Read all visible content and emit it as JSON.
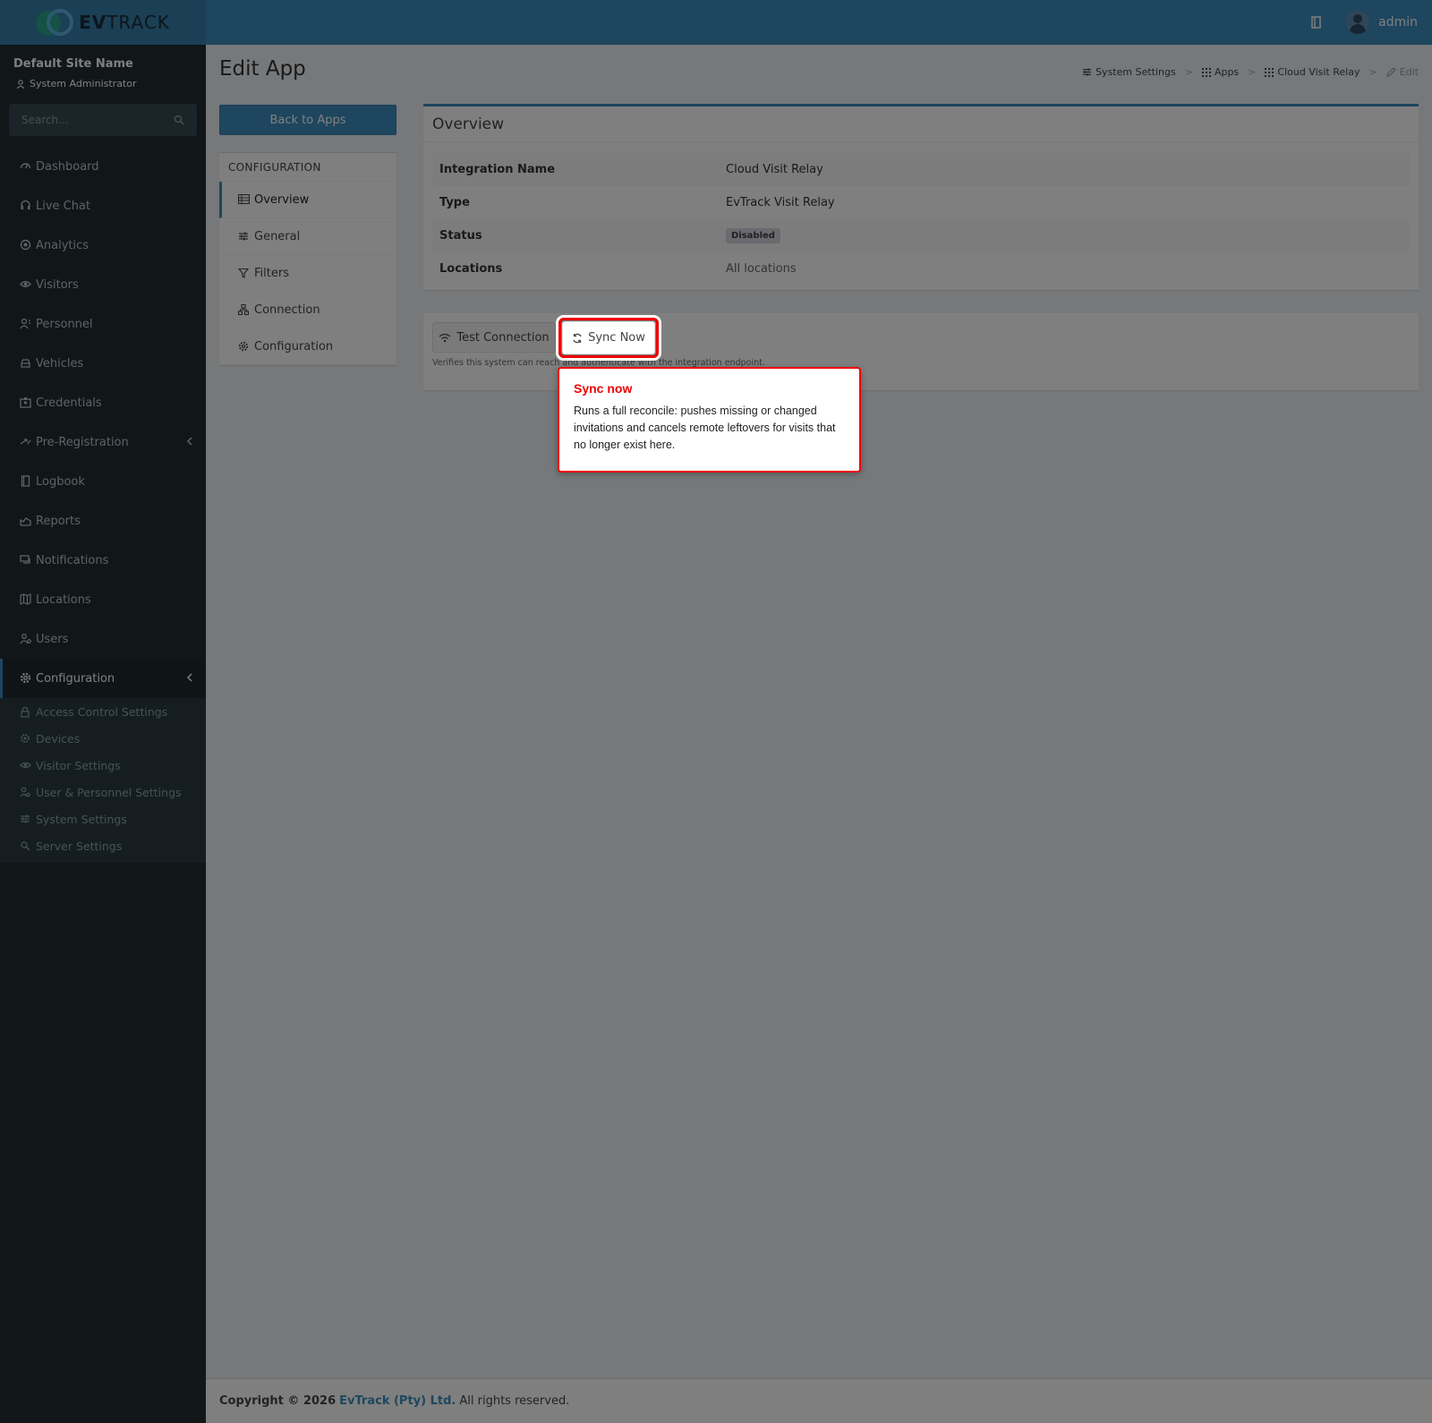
{
  "header": {
    "logo_text_bold": "EV",
    "logo_text_rest": "TRACK",
    "user_name": "admin"
  },
  "sidebar": {
    "site_name": "Default Site Name",
    "role": "System Administrator",
    "search_placeholder": "Search...",
    "items": [
      {
        "label": "Dashboard",
        "icon": "dashboard-icon"
      },
      {
        "label": "Live Chat",
        "icon": "headset-icon"
      },
      {
        "label": "Analytics",
        "icon": "target-icon"
      },
      {
        "label": "Visitors",
        "icon": "eye-icon"
      },
      {
        "label": "Personnel",
        "icon": "user-tie-icon"
      },
      {
        "label": "Vehicles",
        "icon": "car-icon"
      },
      {
        "label": "Credentials",
        "icon": "id-card-icon"
      },
      {
        "label": "Pre-Registration",
        "icon": "arrows-icon"
      },
      {
        "label": "Logbook",
        "icon": "book-icon"
      },
      {
        "label": "Reports",
        "icon": "chart-icon"
      },
      {
        "label": "Notifications",
        "icon": "chat-icon"
      },
      {
        "label": "Locations",
        "icon": "map-icon"
      },
      {
        "label": "Users",
        "icon": "users-icon"
      },
      {
        "label": "Configuration",
        "icon": "gear-icon"
      }
    ],
    "submenu": [
      {
        "label": "Access Control Settings",
        "icon": "lock-icon"
      },
      {
        "label": "Devices",
        "icon": "cog-icon"
      },
      {
        "label": "Visitor Settings",
        "icon": "eye-icon"
      },
      {
        "label": "User & Personnel Settings",
        "icon": "users-gear-icon"
      },
      {
        "label": "System Settings",
        "icon": "sliders-icon"
      },
      {
        "label": "Server Settings",
        "icon": "server-icon"
      }
    ]
  },
  "page": {
    "title": "Edit App",
    "breadcrumb": [
      "System Settings",
      "Apps",
      "Cloud Visit Relay",
      "Edit"
    ],
    "back_button": "Back to Apps"
  },
  "config_menu": {
    "header": "CONFIGURATION",
    "items": [
      "Overview",
      "General",
      "Filters",
      "Connection",
      "Configuration"
    ]
  },
  "overview": {
    "title": "Overview",
    "rows": [
      {
        "label": "Integration Name",
        "value": "Cloud Visit Relay"
      },
      {
        "label": "Type",
        "value": "EvTrack Visit Relay"
      },
      {
        "label": "Status",
        "value": "Disabled"
      },
      {
        "label": "Locations",
        "value": "All locations"
      }
    ]
  },
  "actions": {
    "test_button": "Test Connection",
    "sync_button": "Sync Now",
    "help_text": "Verifies this system can reach and authenticate with the integration endpoint."
  },
  "tooltip": {
    "title": "Sync now",
    "body": "Runs a full reconcile: pushes missing or changed invitations and cancels remote leftovers for visits that no longer exist here."
  },
  "footer": {
    "copyright": "Copyright © 2026",
    "company": "EvTrack (Pty) Ltd.",
    "rights": "All rights reserved."
  }
}
